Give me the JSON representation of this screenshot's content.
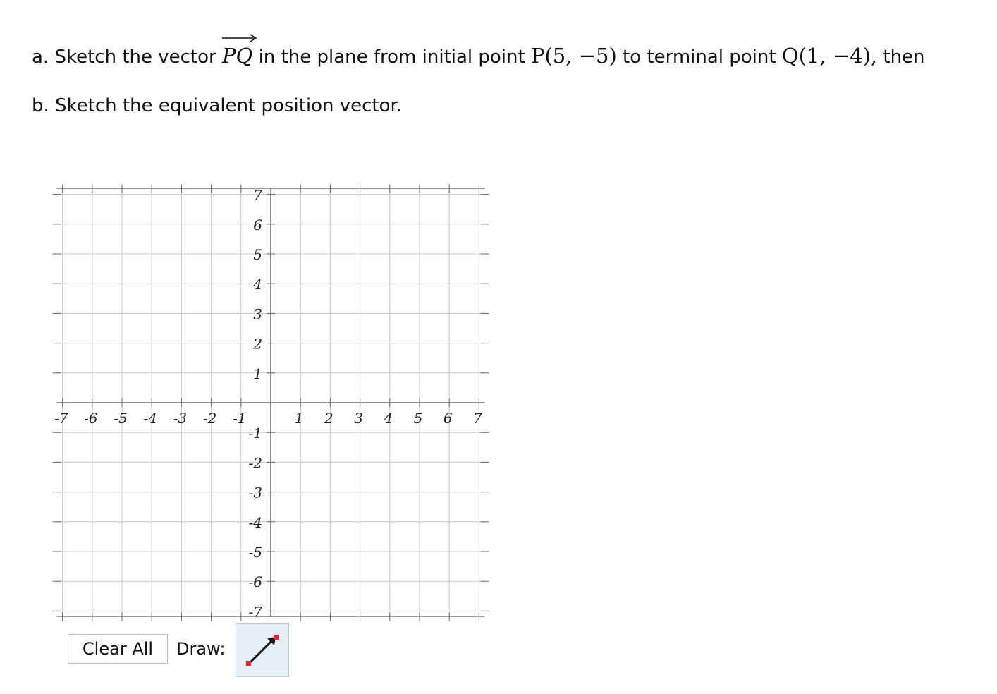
{
  "question": {
    "part_a": {
      "prefix": "a. Sketch the vector",
      "vector_name": "PQ",
      "middle": "in the plane from initial point",
      "initial_point": "P(5, −5)",
      "connector": "to terminal point",
      "terminal_point": "Q(1, −4),",
      "suffix": "then"
    },
    "part_b": "b. Sketch the equivalent position vector."
  },
  "graph": {
    "x_range": [
      -7,
      7
    ],
    "y_range": [
      -7,
      7
    ],
    "grid": true,
    "x_tick_labels": [
      "-7",
      "-6",
      "-5",
      "-4",
      "-3",
      "-2",
      "-1",
      "1",
      "2",
      "3",
      "4",
      "5",
      "6",
      "7"
    ],
    "y_tick_labels": [
      "7",
      "6",
      "5",
      "4",
      "3",
      "2",
      "1",
      "-1",
      "-2",
      "-3",
      "-4",
      "-5",
      "-6",
      "-7"
    ]
  },
  "toolbar": {
    "clear_label": "Clear All",
    "draw_label": "Draw:",
    "tool_icon": "vector-arrow-icon",
    "accent_color": "#e8212b"
  }
}
